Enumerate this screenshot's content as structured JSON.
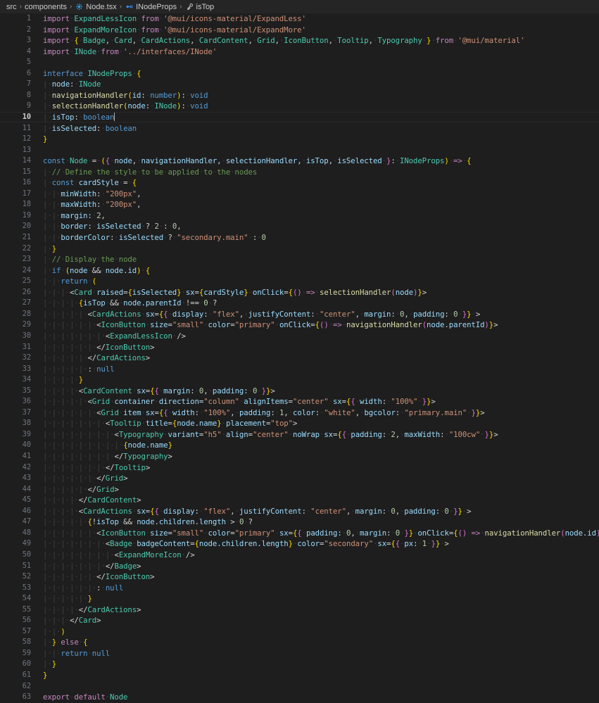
{
  "window": {
    "background": "#1e1e1e",
    "editor_background": "#1e1e1e",
    "breadcrumb_background": "#252526"
  },
  "breadcrumb": {
    "separator": "›",
    "items": [
      {
        "label": "src",
        "icon": null
      },
      {
        "label": "components",
        "icon": null
      },
      {
        "label": "Node.tsx",
        "icon": "react-component-icon"
      },
      {
        "label": "INodeProps",
        "icon": "interface-icon"
      },
      {
        "label": "isTop",
        "icon": "property-icon"
      }
    ]
  },
  "editor": {
    "file_name": "Node.tsx",
    "language": "typescriptreact",
    "active_line": 10,
    "cursor_line": 10,
    "cursor_column": 19,
    "total_lines_shown": 63,
    "lines": [
      {
        "n": 1,
        "text": "import ExpandLessIcon from '@mui/icons-material/ExpandLess'"
      },
      {
        "n": 2,
        "text": "import ExpandMoreIcon from '@mui/icons-material/ExpandMore'"
      },
      {
        "n": 3,
        "text": "import { Badge, Card, CardActions, CardContent, Grid, IconButton, Tooltip, Typography } from '@mui/material'"
      },
      {
        "n": 4,
        "text": "import INode from '../interfaces/INode'"
      },
      {
        "n": 5,
        "text": ""
      },
      {
        "n": 6,
        "text": "interface INodeProps {"
      },
      {
        "n": 7,
        "text": "  node: INode"
      },
      {
        "n": 8,
        "text": "  navigationHandler(id: number): void"
      },
      {
        "n": 9,
        "text": "  selectionHandler(node: INode): void"
      },
      {
        "n": 10,
        "text": "  isTop: boolean"
      },
      {
        "n": 11,
        "text": "  isSelected: boolean"
      },
      {
        "n": 12,
        "text": "}"
      },
      {
        "n": 13,
        "text": ""
      },
      {
        "n": 14,
        "text": "const Node = ({ node, navigationHandler, selectionHandler, isTop, isSelected }: INodeProps) => {"
      },
      {
        "n": 15,
        "text": "  // Define the style to be applied to the nodes"
      },
      {
        "n": 16,
        "text": "  const cardStyle = {"
      },
      {
        "n": 17,
        "text": "    minWidth: \"200px\","
      },
      {
        "n": 18,
        "text": "    maxWidth: \"200px\","
      },
      {
        "n": 19,
        "text": "    margin: 2,"
      },
      {
        "n": 20,
        "text": "    border: isSelected ? 2 : 0,"
      },
      {
        "n": 21,
        "text": "    borderColor: isSelected ? \"secondary.main\" : 0"
      },
      {
        "n": 22,
        "text": "  }"
      },
      {
        "n": 23,
        "text": "  // Display the node"
      },
      {
        "n": 24,
        "text": "  if (node && node.id) {"
      },
      {
        "n": 25,
        "text": "    return ("
      },
      {
        "n": 26,
        "text": "      <Card raised={isSelected} sx={cardStyle} onClick={() => selectionHandler(node)}>"
      },
      {
        "n": 27,
        "text": "        {isTop && node.parentId !== 0 ?"
      },
      {
        "n": 28,
        "text": "          <CardActions sx={{ display: \"flex\", justifyContent: \"center\", margin: 0, padding: 0 }} >"
      },
      {
        "n": 29,
        "text": "            <IconButton size=\"small\" color=\"primary\" onClick={() => navigationHandler(node.parentId)}>"
      },
      {
        "n": 30,
        "text": "              <ExpandLessIcon />"
      },
      {
        "n": 31,
        "text": "            </IconButton>"
      },
      {
        "n": 32,
        "text": "          </CardActions>"
      },
      {
        "n": 33,
        "text": "          : null"
      },
      {
        "n": 34,
        "text": "        }"
      },
      {
        "n": 35,
        "text": "        <CardContent sx={{ margin: 0, padding: 0 }}>"
      },
      {
        "n": 36,
        "text": "          <Grid container direction=\"column\" alignItems=\"center\" sx={{ width: \"100%\" }}>"
      },
      {
        "n": 37,
        "text": "            <Grid item sx={{ width: \"100%\", padding: 1, color: \"white\", bgcolor: \"primary.main\" }}>"
      },
      {
        "n": 38,
        "text": "              <Tooltip title={node.name} placement=\"top\">"
      },
      {
        "n": 39,
        "text": "                <Typography variant=\"h5\" align=\"center\" noWrap sx={{ padding: 2, maxWidth: \"100cw\" }}>"
      },
      {
        "n": 40,
        "text": "                  {node.name}"
      },
      {
        "n": 41,
        "text": "                </Typography>"
      },
      {
        "n": 42,
        "text": "              </Tooltip>"
      },
      {
        "n": 43,
        "text": "            </Grid>"
      },
      {
        "n": 44,
        "text": "          </Grid>"
      },
      {
        "n": 45,
        "text": "        </CardContent>"
      },
      {
        "n": 46,
        "text": "        <CardActions sx={{ display: \"flex\", justifyContent: \"center\", margin: 0, padding: 0 }} >"
      },
      {
        "n": 47,
        "text": "          {!isTop && node.children.length > 0 ?"
      },
      {
        "n": 48,
        "text": "            <IconButton size=\"small\" color=\"primary\" sx={{ padding: 0, margin: 0 }} onClick={() => navigationHandler(node.id)}>"
      },
      {
        "n": 49,
        "text": "              <Badge badgeContent={node.children.length} color=\"secondary\" sx={{ px: 1 }} >"
      },
      {
        "n": 50,
        "text": "                <ExpandMoreIcon />"
      },
      {
        "n": 51,
        "text": "              </Badge>"
      },
      {
        "n": 52,
        "text": "            </IconButton>"
      },
      {
        "n": 53,
        "text": "            : null"
      },
      {
        "n": 54,
        "text": "          }"
      },
      {
        "n": 55,
        "text": "        </CardActions>"
      },
      {
        "n": 56,
        "text": "      </Card>"
      },
      {
        "n": 57,
        "text": "    )"
      },
      {
        "n": 58,
        "text": "  } else {"
      },
      {
        "n": 59,
        "text": "    return null"
      },
      {
        "n": 60,
        "text": "  }"
      },
      {
        "n": 61,
        "text": "}"
      },
      {
        "n": 62,
        "text": ""
      },
      {
        "n": 63,
        "text": "export default Node"
      }
    ]
  },
  "theme": {
    "keyword": "#c586c0",
    "keyword_control": "#569cd6",
    "type": "#4ec9b0",
    "variable": "#9cdcfe",
    "string": "#ce9178",
    "number": "#b5cea8",
    "comment": "#6a9955",
    "function": "#dcdcaa",
    "punctuation": "#d4d4d4",
    "line_number": "#6e7681",
    "cursor": "#aeafad"
  }
}
